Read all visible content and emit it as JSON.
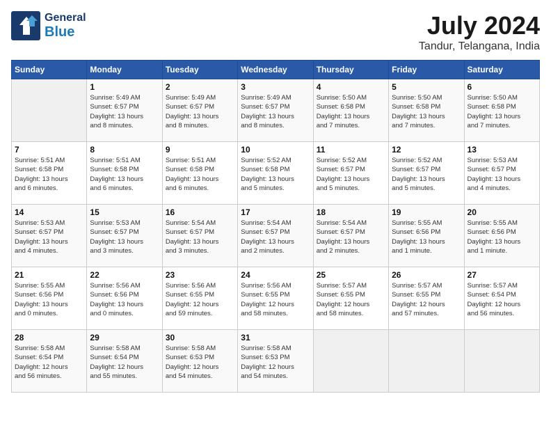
{
  "header": {
    "logo_general": "General",
    "logo_blue": "Blue",
    "month_year": "July 2024",
    "location": "Tandur, Telangana, India"
  },
  "days_of_week": [
    "Sunday",
    "Monday",
    "Tuesday",
    "Wednesday",
    "Thursday",
    "Friday",
    "Saturday"
  ],
  "weeks": [
    [
      {
        "day": "",
        "detail": ""
      },
      {
        "day": "1",
        "detail": "Sunrise: 5:49 AM\nSunset: 6:57 PM\nDaylight: 13 hours\nand 8 minutes."
      },
      {
        "day": "2",
        "detail": "Sunrise: 5:49 AM\nSunset: 6:57 PM\nDaylight: 13 hours\nand 8 minutes."
      },
      {
        "day": "3",
        "detail": "Sunrise: 5:49 AM\nSunset: 6:57 PM\nDaylight: 13 hours\nand 8 minutes."
      },
      {
        "day": "4",
        "detail": "Sunrise: 5:50 AM\nSunset: 6:58 PM\nDaylight: 13 hours\nand 7 minutes."
      },
      {
        "day": "5",
        "detail": "Sunrise: 5:50 AM\nSunset: 6:58 PM\nDaylight: 13 hours\nand 7 minutes."
      },
      {
        "day": "6",
        "detail": "Sunrise: 5:50 AM\nSunset: 6:58 PM\nDaylight: 13 hours\nand 7 minutes."
      }
    ],
    [
      {
        "day": "7",
        "detail": "Sunrise: 5:51 AM\nSunset: 6:58 PM\nDaylight: 13 hours\nand 6 minutes."
      },
      {
        "day": "8",
        "detail": "Sunrise: 5:51 AM\nSunset: 6:58 PM\nDaylight: 13 hours\nand 6 minutes."
      },
      {
        "day": "9",
        "detail": "Sunrise: 5:51 AM\nSunset: 6:58 PM\nDaylight: 13 hours\nand 6 minutes."
      },
      {
        "day": "10",
        "detail": "Sunrise: 5:52 AM\nSunset: 6:58 PM\nDaylight: 13 hours\nand 5 minutes."
      },
      {
        "day": "11",
        "detail": "Sunrise: 5:52 AM\nSunset: 6:57 PM\nDaylight: 13 hours\nand 5 minutes."
      },
      {
        "day": "12",
        "detail": "Sunrise: 5:52 AM\nSunset: 6:57 PM\nDaylight: 13 hours\nand 5 minutes."
      },
      {
        "day": "13",
        "detail": "Sunrise: 5:53 AM\nSunset: 6:57 PM\nDaylight: 13 hours\nand 4 minutes."
      }
    ],
    [
      {
        "day": "14",
        "detail": "Sunrise: 5:53 AM\nSunset: 6:57 PM\nDaylight: 13 hours\nand 4 minutes."
      },
      {
        "day": "15",
        "detail": "Sunrise: 5:53 AM\nSunset: 6:57 PM\nDaylight: 13 hours\nand 3 minutes."
      },
      {
        "day": "16",
        "detail": "Sunrise: 5:54 AM\nSunset: 6:57 PM\nDaylight: 13 hours\nand 3 minutes."
      },
      {
        "day": "17",
        "detail": "Sunrise: 5:54 AM\nSunset: 6:57 PM\nDaylight: 13 hours\nand 2 minutes."
      },
      {
        "day": "18",
        "detail": "Sunrise: 5:54 AM\nSunset: 6:57 PM\nDaylight: 13 hours\nand 2 minutes."
      },
      {
        "day": "19",
        "detail": "Sunrise: 5:55 AM\nSunset: 6:56 PM\nDaylight: 13 hours\nand 1 minute."
      },
      {
        "day": "20",
        "detail": "Sunrise: 5:55 AM\nSunset: 6:56 PM\nDaylight: 13 hours\nand 1 minute."
      }
    ],
    [
      {
        "day": "21",
        "detail": "Sunrise: 5:55 AM\nSunset: 6:56 PM\nDaylight: 13 hours\nand 0 minutes."
      },
      {
        "day": "22",
        "detail": "Sunrise: 5:56 AM\nSunset: 6:56 PM\nDaylight: 13 hours\nand 0 minutes."
      },
      {
        "day": "23",
        "detail": "Sunrise: 5:56 AM\nSunset: 6:55 PM\nDaylight: 12 hours\nand 59 minutes."
      },
      {
        "day": "24",
        "detail": "Sunrise: 5:56 AM\nSunset: 6:55 PM\nDaylight: 12 hours\nand 58 minutes."
      },
      {
        "day": "25",
        "detail": "Sunrise: 5:57 AM\nSunset: 6:55 PM\nDaylight: 12 hours\nand 58 minutes."
      },
      {
        "day": "26",
        "detail": "Sunrise: 5:57 AM\nSunset: 6:55 PM\nDaylight: 12 hours\nand 57 minutes."
      },
      {
        "day": "27",
        "detail": "Sunrise: 5:57 AM\nSunset: 6:54 PM\nDaylight: 12 hours\nand 56 minutes."
      }
    ],
    [
      {
        "day": "28",
        "detail": "Sunrise: 5:58 AM\nSunset: 6:54 PM\nDaylight: 12 hours\nand 56 minutes."
      },
      {
        "day": "29",
        "detail": "Sunrise: 5:58 AM\nSunset: 6:54 PM\nDaylight: 12 hours\nand 55 minutes."
      },
      {
        "day": "30",
        "detail": "Sunrise: 5:58 AM\nSunset: 6:53 PM\nDaylight: 12 hours\nand 54 minutes."
      },
      {
        "day": "31",
        "detail": "Sunrise: 5:58 AM\nSunset: 6:53 PM\nDaylight: 12 hours\nand 54 minutes."
      },
      {
        "day": "",
        "detail": ""
      },
      {
        "day": "",
        "detail": ""
      },
      {
        "day": "",
        "detail": ""
      }
    ]
  ]
}
